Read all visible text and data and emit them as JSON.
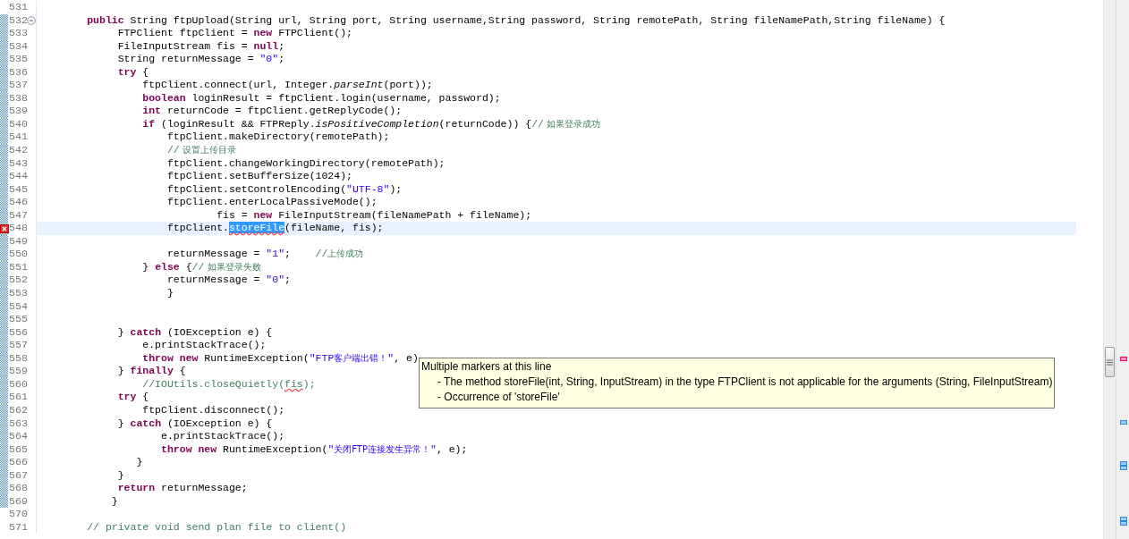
{
  "editor": {
    "lines": [
      {
        "num": "531",
        "changed": false,
        "current": false,
        "fold": false,
        "error": false
      },
      {
        "num": "532",
        "changed": true,
        "current": false,
        "fold": true,
        "error": false,
        "tokens": [
          {
            "kind": "kw",
            "t": "        public"
          },
          {
            "kind": "plain",
            "t": " String ftpUpload(String url, String port, String username,String password, String remotePath, String fileNamePath,String fileName) {"
          }
        ]
      },
      {
        "num": "533",
        "changed": true,
        "current": false,
        "fold": false,
        "error": false,
        "tokens": [
          {
            "kind": "plain",
            "t": "             FTPClient ftpClient = "
          },
          {
            "kind": "kw",
            "t": "new"
          },
          {
            "kind": "plain",
            "t": " FTPClient();"
          }
        ]
      },
      {
        "num": "534",
        "changed": true,
        "current": false,
        "fold": false,
        "error": false,
        "tokens": [
          {
            "kind": "plain",
            "t": "             FileInputStream fis = "
          },
          {
            "kind": "kw",
            "t": "null"
          },
          {
            "kind": "plain",
            "t": ";"
          }
        ]
      },
      {
        "num": "535",
        "changed": true,
        "current": false,
        "fold": false,
        "error": false,
        "tokens": [
          {
            "kind": "plain",
            "t": "             String returnMessage = "
          },
          {
            "kind": "str",
            "t": "\"0\""
          },
          {
            "kind": "plain",
            "t": ";"
          }
        ]
      },
      {
        "num": "536",
        "changed": true,
        "current": false,
        "fold": false,
        "error": false,
        "tokens": [
          {
            "kind": "kw",
            "t": "             try"
          },
          {
            "kind": "plain",
            "t": " {"
          }
        ]
      },
      {
        "num": "537",
        "changed": true,
        "current": false,
        "fold": false,
        "error": false,
        "tokens": [
          {
            "kind": "plain",
            "t": "                 ftpClient.connect(url, Integer."
          },
          {
            "kind": "static",
            "t": "parseInt"
          },
          {
            "kind": "plain",
            "t": "(port));"
          }
        ]
      },
      {
        "num": "538",
        "changed": true,
        "current": false,
        "fold": false,
        "error": false,
        "tokens": [
          {
            "kind": "kw",
            "t": "                 boolean"
          },
          {
            "kind": "plain",
            "t": " loginResult = ftpClient.login(username, password);"
          }
        ]
      },
      {
        "num": "539",
        "changed": true,
        "current": false,
        "fold": false,
        "error": false,
        "tokens": [
          {
            "kind": "kw",
            "t": "                 int"
          },
          {
            "kind": "plain",
            "t": " returnCode = ftpClient.getReplyCode();"
          }
        ]
      },
      {
        "num": "540",
        "changed": true,
        "current": false,
        "fold": false,
        "error": false,
        "tokens": [
          {
            "kind": "kw",
            "t": "                 if"
          },
          {
            "kind": "plain",
            "t": " (loginResult && FTPReply."
          },
          {
            "kind": "static",
            "t": "isPositiveCompletion"
          },
          {
            "kind": "plain",
            "t": "(returnCode)) {"
          },
          {
            "kind": "cmt",
            "t": "//"
          },
          {
            "kind": "cjk",
            "t": " 如果登录成功"
          }
        ]
      },
      {
        "num": "541",
        "changed": true,
        "current": false,
        "fold": false,
        "error": false,
        "tokens": [
          {
            "kind": "plain",
            "t": "                     ftpClient.makeDirectory(remotePath);"
          }
        ]
      },
      {
        "num": "542",
        "changed": true,
        "current": false,
        "fold": false,
        "error": false,
        "tokens": [
          {
            "kind": "cmt",
            "t": "                     //"
          },
          {
            "kind": "cjk",
            "t": " 设置上传目录"
          }
        ]
      },
      {
        "num": "543",
        "changed": true,
        "current": false,
        "fold": false,
        "error": false,
        "tokens": [
          {
            "kind": "plain",
            "t": "                     ftpClient.changeWorkingDirectory(remotePath);"
          }
        ]
      },
      {
        "num": "544",
        "changed": true,
        "current": false,
        "fold": false,
        "error": false,
        "tokens": [
          {
            "kind": "plain",
            "t": "                     ftpClient.setBufferSize(1024);"
          }
        ]
      },
      {
        "num": "545",
        "changed": true,
        "current": false,
        "fold": false,
        "error": false,
        "tokens": [
          {
            "kind": "plain",
            "t": "                     ftpClient.setControlEncoding("
          },
          {
            "kind": "str",
            "t": "\"UTF-8\""
          },
          {
            "kind": "plain",
            "t": ");"
          }
        ]
      },
      {
        "num": "546",
        "changed": true,
        "current": false,
        "fold": false,
        "error": false,
        "tokens": [
          {
            "kind": "plain",
            "t": "                     ftpClient.enterLocalPassiveMode();"
          }
        ]
      },
      {
        "num": "547",
        "changed": true,
        "current": false,
        "fold": false,
        "error": false,
        "tokens": [
          {
            "kind": "plain",
            "t": "                             fis = "
          },
          {
            "kind": "kw",
            "t": "new"
          },
          {
            "kind": "plain",
            "t": " FileInputStream(fileNamePath + fileName);"
          }
        ]
      },
      {
        "num": "548",
        "changed": true,
        "current": true,
        "fold": false,
        "error": true,
        "tokens": [
          {
            "kind": "plain",
            "t": "                     ftpClient."
          },
          {
            "kind": "sel",
            "t": "storeFile"
          },
          {
            "kind": "plain",
            "t": "(fileName, fis);"
          }
        ]
      },
      {
        "num": "549",
        "changed": true,
        "current": false,
        "fold": false,
        "error": false
      },
      {
        "num": "550",
        "changed": true,
        "current": false,
        "fold": false,
        "error": false,
        "tokens": [
          {
            "kind": "plain",
            "t": "                     returnMessage = "
          },
          {
            "kind": "str",
            "t": "\"1\""
          },
          {
            "kind": "plain",
            "t": ";"
          },
          {
            "kind": "cmt",
            "t": "    //"
          },
          {
            "kind": "cjk",
            "t": "上传成功"
          }
        ]
      },
      {
        "num": "551",
        "changed": true,
        "current": false,
        "fold": false,
        "error": false,
        "tokens": [
          {
            "kind": "plain",
            "t": "                 }"
          },
          {
            "kind": "kw",
            "t": " else"
          },
          {
            "kind": "plain",
            "t": " {"
          },
          {
            "kind": "cmt",
            "t": "//"
          },
          {
            "kind": "cjk",
            "t": " 如果登录失败"
          }
        ]
      },
      {
        "num": "552",
        "changed": true,
        "current": false,
        "fold": false,
        "error": false,
        "tokens": [
          {
            "kind": "plain",
            "t": "                     returnMessage = "
          },
          {
            "kind": "str",
            "t": "\"0\""
          },
          {
            "kind": "plain",
            "t": ";"
          }
        ]
      },
      {
        "num": "553",
        "changed": true,
        "current": false,
        "fold": false,
        "error": false,
        "tokens": [
          {
            "kind": "plain",
            "t": "                     }"
          }
        ]
      },
      {
        "num": "554",
        "changed": true,
        "current": false,
        "fold": false,
        "error": false
      },
      {
        "num": "555",
        "changed": true,
        "current": false,
        "fold": false,
        "error": false
      },
      {
        "num": "556",
        "changed": true,
        "current": false,
        "fold": false,
        "error": false,
        "tokens": [
          {
            "kind": "plain",
            "t": "             }"
          },
          {
            "kind": "kw",
            "t": " catch"
          },
          {
            "kind": "plain",
            "t": " (IOException e) {"
          }
        ]
      },
      {
        "num": "557",
        "changed": true,
        "current": false,
        "fold": false,
        "error": false,
        "tokens": [
          {
            "kind": "plain",
            "t": "                 e.printStackTrace();"
          }
        ]
      },
      {
        "num": "558",
        "changed": true,
        "current": false,
        "fold": false,
        "error": false,
        "tokens": [
          {
            "kind": "kw",
            "t": "                 throw new"
          },
          {
            "kind": "plain",
            "t": " RuntimeException("
          },
          {
            "kind": "str",
            "t": "\"FTP"
          },
          {
            "kind": "strcjk",
            "t": "客户端出错！"
          },
          {
            "kind": "str",
            "t": "\""
          },
          {
            "kind": "plain",
            "t": ", e)"
          }
        ]
      },
      {
        "num": "559",
        "changed": true,
        "current": false,
        "fold": false,
        "error": false,
        "tokens": [
          {
            "kind": "plain",
            "t": "             }"
          },
          {
            "kind": "kw",
            "t": " finally"
          },
          {
            "kind": "plain",
            "t": " {"
          }
        ]
      },
      {
        "num": "560",
        "changed": true,
        "current": false,
        "fold": false,
        "error": false,
        "tokens": [
          {
            "kind": "cmt",
            "t": "                 //IOUtils.closeQuietly("
          },
          {
            "kind": "cmtwarn",
            "t": "fis"
          },
          {
            "kind": "cmt",
            "t": ");"
          }
        ]
      },
      {
        "num": "561",
        "changed": true,
        "current": false,
        "fold": false,
        "error": false,
        "tokens": [
          {
            "kind": "kw",
            "t": "             try"
          },
          {
            "kind": "plain",
            "t": " {"
          }
        ]
      },
      {
        "num": "562",
        "changed": true,
        "current": false,
        "fold": false,
        "error": false,
        "tokens": [
          {
            "kind": "plain",
            "t": "                 ftpClient.disconnect();"
          }
        ]
      },
      {
        "num": "563",
        "changed": true,
        "current": false,
        "fold": false,
        "error": false,
        "tokens": [
          {
            "kind": "plain",
            "t": "             }"
          },
          {
            "kind": "kw",
            "t": " catch"
          },
          {
            "kind": "plain",
            "t": " (IOException e) {"
          }
        ]
      },
      {
        "num": "564",
        "changed": true,
        "current": false,
        "fold": false,
        "error": false,
        "tokens": [
          {
            "kind": "plain",
            "t": "                    e.printStackTrace();"
          }
        ]
      },
      {
        "num": "565",
        "changed": true,
        "current": false,
        "fold": false,
        "error": false,
        "tokens": [
          {
            "kind": "kw",
            "t": "                    throw new"
          },
          {
            "kind": "plain",
            "t": " RuntimeException("
          },
          {
            "kind": "str",
            "t": "\""
          },
          {
            "kind": "strcjk",
            "t": "关闭FTP连接发生异常！"
          },
          {
            "kind": "str",
            "t": "\""
          },
          {
            "kind": "plain",
            "t": ", e);"
          }
        ]
      },
      {
        "num": "566",
        "changed": true,
        "current": false,
        "fold": false,
        "error": false,
        "tokens": [
          {
            "kind": "plain",
            "t": "                }"
          }
        ]
      },
      {
        "num": "567",
        "changed": true,
        "current": false,
        "fold": false,
        "error": false,
        "tokens": [
          {
            "kind": "plain",
            "t": "             }"
          }
        ]
      },
      {
        "num": "568",
        "changed": true,
        "current": false,
        "fold": false,
        "error": false,
        "tokens": [
          {
            "kind": "kw",
            "t": "             return"
          },
          {
            "kind": "plain",
            "t": " returnMessage;"
          }
        ]
      },
      {
        "num": "569",
        "changed": true,
        "current": false,
        "fold": false,
        "error": false,
        "tokens": [
          {
            "kind": "plain",
            "t": "            }"
          }
        ]
      },
      {
        "num": "570",
        "changed": false,
        "current": false,
        "fold": false,
        "error": false
      },
      {
        "num": "571",
        "changed": false,
        "current": false,
        "fold": false,
        "error": false,
        "tokens": [
          {
            "kind": "cmt",
            "t": "        // private void send plan file to client()"
          }
        ]
      }
    ]
  },
  "tooltip": {
    "title": "Multiple markers at this line",
    "items": [
      "- The method storeFile(int, String, InputStream) in the type FTPClient is not applicable for the arguments (String, FileInputStream)",
      "- Occurrence of 'storeFile'"
    ]
  }
}
